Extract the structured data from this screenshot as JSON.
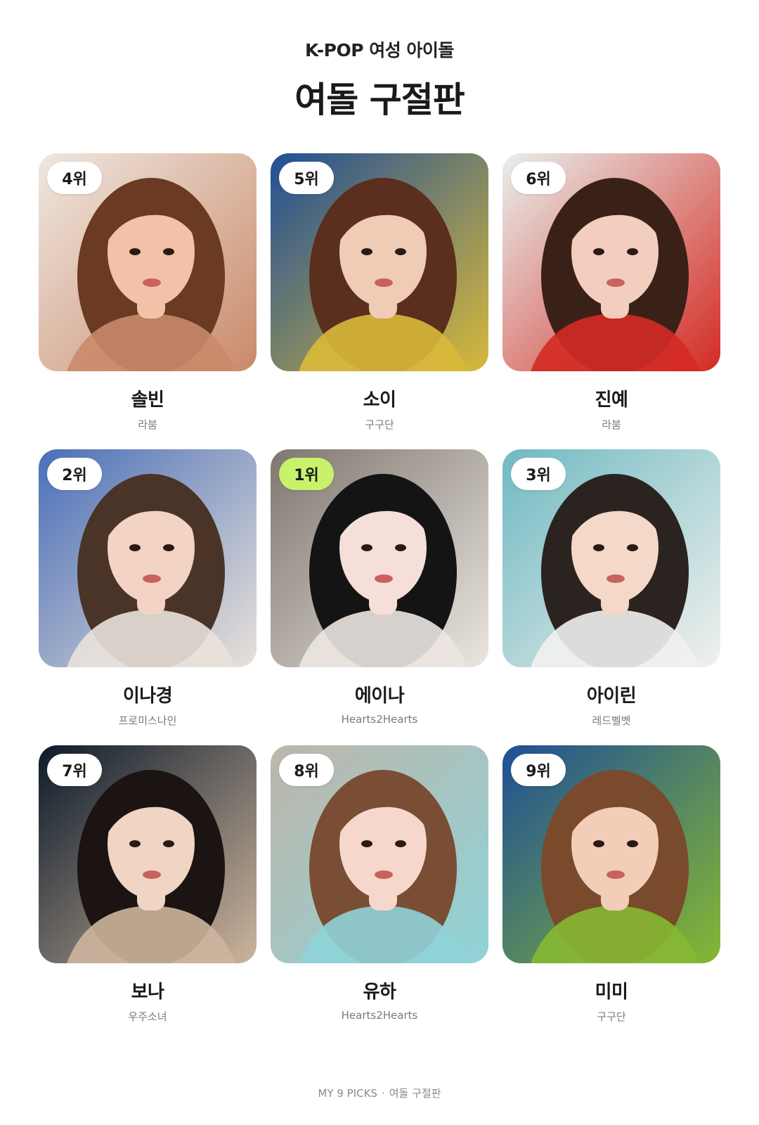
{
  "header": {
    "subtitle": "K-POP 여성 아이돌",
    "title": "여돌 구절판"
  },
  "cards": [
    {
      "rank": "4위",
      "name": "솔빈",
      "group": "라붐",
      "highlight": false,
      "palette": {
        "bg": "#efe7df",
        "accent": "#c98a6a",
        "hair": "#6a3a22",
        "skin": "#f2c2a8"
      }
    },
    {
      "rank": "5위",
      "name": "소이",
      "group": "구구단",
      "highlight": false,
      "palette": {
        "bg": "#1f4f96",
        "accent": "#d9b93a",
        "hair": "#5a2f1e",
        "skin": "#f0cbb5"
      }
    },
    {
      "rank": "6위",
      "name": "진예",
      "group": "라붐",
      "highlight": false,
      "palette": {
        "bg": "#e8f0ec",
        "accent": "#d42a23",
        "hair": "#3a2118",
        "skin": "#f3cdbd"
      }
    },
    {
      "rank": "2위",
      "name": "이나경",
      "group": "프로미스나인",
      "highlight": false,
      "palette": {
        "bg": "#4a6fb8",
        "accent": "#e9e2da",
        "hair": "#4a3428",
        "skin": "#f3d3c4"
      }
    },
    {
      "rank": "1위",
      "name": "에이나",
      "group": "Hearts2Hearts",
      "highlight": true,
      "palette": {
        "bg": "#7d776f",
        "accent": "#ece6e1",
        "hair": "#141414",
        "skin": "#f6dfd8"
      }
    },
    {
      "rank": "3위",
      "name": "아이린",
      "group": "레드벨벳",
      "highlight": false,
      "palette": {
        "bg": "#6fb9c2",
        "accent": "#f1f1ee",
        "hair": "#2a2320",
        "skin": "#f4d8c8"
      }
    },
    {
      "rank": "7위",
      "name": "보나",
      "group": "우주소녀",
      "highlight": false,
      "palette": {
        "bg": "#0c1a2a",
        "accent": "#cdb59d",
        "hair": "#1b1412",
        "skin": "#f0d5c4"
      }
    },
    {
      "rank": "8위",
      "name": "유하",
      "group": "Hearts2Hearts",
      "highlight": false,
      "palette": {
        "bg": "#bdb6aa",
        "accent": "#8fd3d8",
        "hair": "#7a4e34",
        "skin": "#f5d7cb"
      }
    },
    {
      "rank": "9위",
      "name": "미미",
      "group": "구구단",
      "highlight": false,
      "palette": {
        "bg": "#1f4f96",
        "accent": "#86b833",
        "hair": "#7a4a2c",
        "skin": "#f2cdb8"
      }
    }
  ],
  "footer": {
    "left": "MY 9 PICKS",
    "separator": "·",
    "right": "여돌 구절판"
  }
}
